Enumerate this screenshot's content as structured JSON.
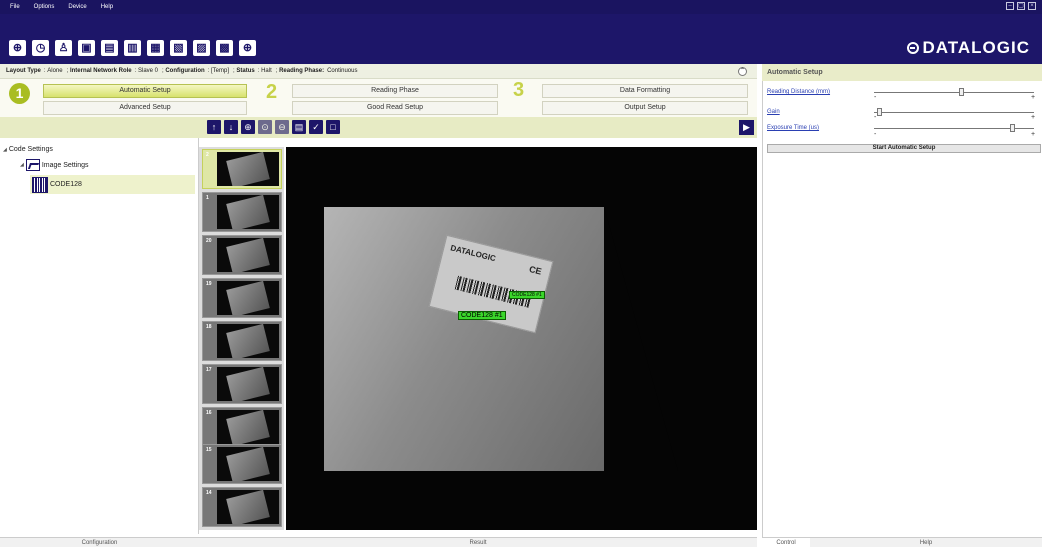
{
  "menu": [
    "File",
    "Options",
    "Device",
    "Help"
  ],
  "toolbar": {
    "icons": [
      "plus-circle-icon",
      "clock-icon",
      "user-icon",
      "window-icon",
      "monitor-icon",
      "monitor-settings-icon",
      "barcode-icon",
      "save-icon",
      "download-icon",
      "upload-icon",
      "crosshair-icon"
    ],
    "glyphs": [
      "⊕",
      "◷",
      "♙",
      "▣",
      "▤",
      "▥",
      "▦",
      "▧",
      "▨",
      "▩",
      "⊕"
    ]
  },
  "brand": "DATALOGIC",
  "status": {
    "layout_label": "Layout Type",
    "layout_value": "Alone",
    "role_label": "Internal Network Role",
    "role_value": "Slave 0",
    "config_label": "Configuration",
    "config_value": "[Temp]",
    "status_label": "Status",
    "status_value": "Halt",
    "phase_label": "Reading Phase:",
    "phase_value": "Continuous"
  },
  "wizard": {
    "steps": [
      "1",
      "2",
      "3"
    ],
    "buttons": [
      "Automatic Setup",
      "Advanced Setup",
      "Reading Phase",
      "Good Read Setup",
      "Data Formatting",
      "Output Setup"
    ]
  },
  "right_panel": {
    "title": "Automatic Setup",
    "params": [
      {
        "label": "Reading Distance (mm)",
        "level": 0.55
      },
      {
        "label": "Gain",
        "level": 0.02
      },
      {
        "label": "Exposure Time (us)",
        "level": 0.88
      }
    ],
    "start_button": "Start Automatic Setup"
  },
  "tree": {
    "root": "Code Settings",
    "child": "Image Settings",
    "leaf": "CODE128"
  },
  "thumbnails": [
    "2",
    "1",
    "20",
    "19",
    "18",
    "17",
    "16",
    "15",
    "14"
  ],
  "image": {
    "label_brand": "DATALOGIC",
    "label_ce": "CE",
    "tags": [
      "CODE128 #1",
      "CODE128 #1"
    ]
  },
  "bottom_tabs": {
    "configuration": "Configuration",
    "result": "Result",
    "control": "Control",
    "help": "Help"
  }
}
